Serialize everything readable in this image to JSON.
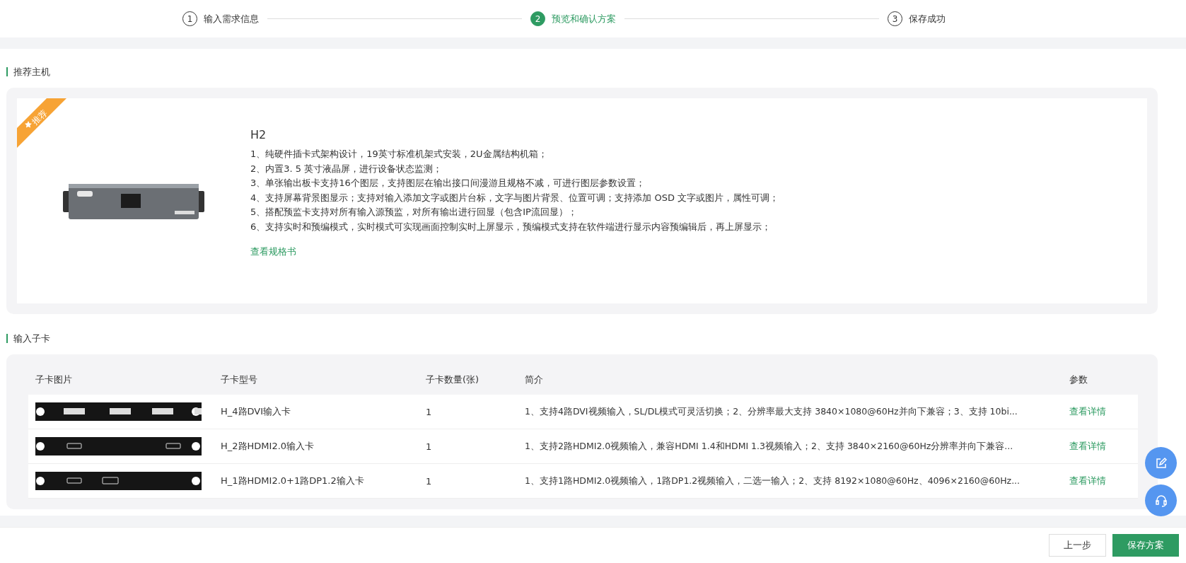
{
  "steps": [
    {
      "number": "1",
      "label": "输入需求信息",
      "selected": false
    },
    {
      "number": "2",
      "label": "预览和确认方案",
      "selected": true
    },
    {
      "number": "3",
      "label": "保存成功",
      "selected": false
    }
  ],
  "host_section": {
    "title": "推荐主机",
    "badge": "推荐",
    "product": {
      "name": "H2",
      "features": [
        "1、纯硬件插卡式架构设计，19英寸标准机架式安装，2U金属结构机箱；",
        "2、内置3. 5 英寸液晶屏，进行设备状态监测；",
        "3、单张输出板卡支持16个图层，支持图层在输出接口间漫游且规格不减，可进行图层参数设置；",
        "4、支持屏幕背景图显示；支持对输入添加文字或图片台标，文字与图片背景、位置可调；支持添加 OSD 文字或图片，属性可调；",
        "5、搭配预监卡支持对所有输入源预监，对所有输出进行回显（包含IP流回显）；",
        "6、支持实时和预编模式，实时模式可实现画面控制实时上屏显示，预编模式支持在软件端进行显示内容预编辑后，再上屏显示；"
      ],
      "link": "查看规格书"
    }
  },
  "cards_section": {
    "title": "输入子卡",
    "columns": [
      "子卡图片",
      "子卡型号",
      "子卡数量(张)",
      "简介",
      "参数"
    ],
    "rows": [
      {
        "kind": "dvi4",
        "model": "H_4路DVI输入卡",
        "count": "1",
        "intro": "1、支持4路DVI视频输入，SL/DL模式可灵活切换；2、分辨率最大支持 3840×1080@60Hz并向下兼容；3、支持 10bi...",
        "link": "查看详情"
      },
      {
        "kind": "hdmi2",
        "model": "H_2路HDMI2.0输入卡",
        "count": "1",
        "intro": "1、支持2路HDMI2.0视频输入，兼容HDMI 1.4和HDMI 1.3视频输入；2、支持 3840×2160@60Hz分辨率并向下兼容...",
        "link": "查看详情"
      },
      {
        "kind": "hdmidp",
        "model": "H_1路HDMI2.0+1路DP1.2输入卡",
        "count": "1",
        "intro": "1、支持1路HDMI2.0视频输入，1路DP1.2视频输入，二选一输入；2、支持 8192×1080@60Hz、4096×2160@60Hz...",
        "link": "查看详情"
      }
    ]
  },
  "footer": {
    "back": "上一步",
    "save": "保存方案"
  }
}
